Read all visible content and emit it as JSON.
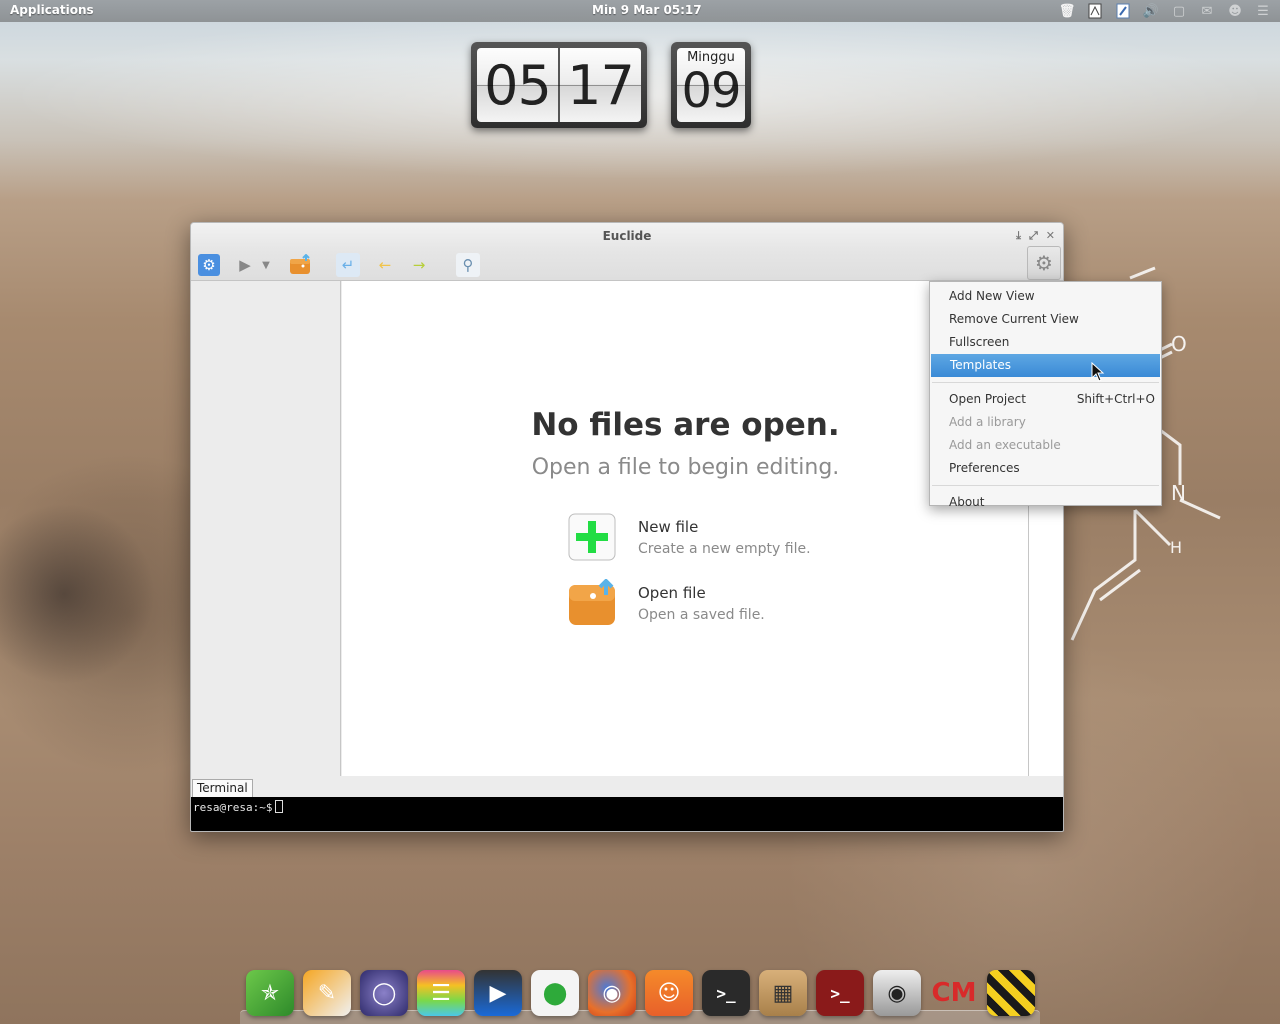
{
  "top_panel": {
    "applications_label": "Applications",
    "clock": "Min  9 Mar 05:17",
    "tray_icons": [
      "trash-icon",
      "document-icon",
      "pen-icon",
      "volume-icon",
      "display-icon",
      "mail-icon",
      "user-icon",
      "menu-icon"
    ]
  },
  "desktop_clock": {
    "hour": "05",
    "minute": "17",
    "day_name": "Minggu",
    "day_number": "09"
  },
  "window": {
    "title": "Euclide",
    "toolbar_icons": [
      "settings-icon",
      "run-icon",
      "dropdown-arrow-icon",
      "open-folder-icon",
      "return-icon",
      "back-arrow-icon",
      "forward-arrow-icon",
      "search-icon"
    ],
    "welcome": {
      "title": "No files are open.",
      "subtitle": "Open a file to begin editing.",
      "new_file_title": "New file",
      "new_file_desc": "Create a new empty file.",
      "open_file_title": "Open file",
      "open_file_desc": "Open a saved file."
    },
    "terminal_tab": "Terminal",
    "terminal_prompt": "resa@resa:~$"
  },
  "menu": {
    "items": [
      {
        "label": "Add New View",
        "state": "enabled"
      },
      {
        "label": "Remove Current View",
        "state": "enabled"
      },
      {
        "label": "Fullscreen",
        "state": "enabled"
      },
      {
        "label": "Templates",
        "state": "active"
      },
      {
        "label": "Open Project",
        "shortcut": "Shift+Ctrl+O",
        "state": "enabled"
      },
      {
        "label": "Add a library",
        "state": "disabled"
      },
      {
        "label": "Add an executable",
        "state": "disabled"
      },
      {
        "label": "Preferences",
        "state": "enabled"
      },
      {
        "label": "About",
        "state": "enabled"
      }
    ]
  },
  "dock": {
    "items": [
      "compass-app",
      "notes-app",
      "sphere-app",
      "stack-app",
      "video-app",
      "toggle-app",
      "firefox-app",
      "store-app",
      "terminal-app",
      "calculator-app",
      "red-terminal-app",
      "camera-app",
      "cm-app",
      "hazard-app"
    ],
    "cm_label": "CM"
  },
  "colors": {
    "menu_highlight": "#3a8ad6",
    "new_file_plus": "#22dd44",
    "folder_orange": "#e8902e"
  }
}
